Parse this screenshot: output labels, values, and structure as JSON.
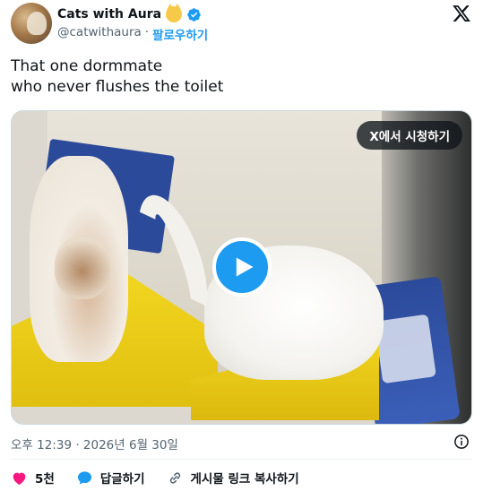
{
  "author": {
    "name": "Cats with Aura",
    "handle": "@catwithaura",
    "separator": "·",
    "follow_label": "팔로우하기",
    "emoji_icon": "cat-face-emoji-icon",
    "verified_color": "#1d9bf0"
  },
  "tweet": {
    "line1": "That one dormmate",
    "line2": "who never flushes the toilet"
  },
  "media": {
    "watch_label": "X에서 시청하기",
    "play_icon": "play-icon"
  },
  "meta": {
    "timestamp": "오후 12:39 · 2026년 6월 30일"
  },
  "actions": {
    "like_count": "5천",
    "reply_label": "답글하기",
    "copy_link_label": "게시물 링크 복사하기"
  },
  "colors": {
    "accent": "#1d9bf0",
    "like": "#f91880",
    "muted": "#536471"
  }
}
